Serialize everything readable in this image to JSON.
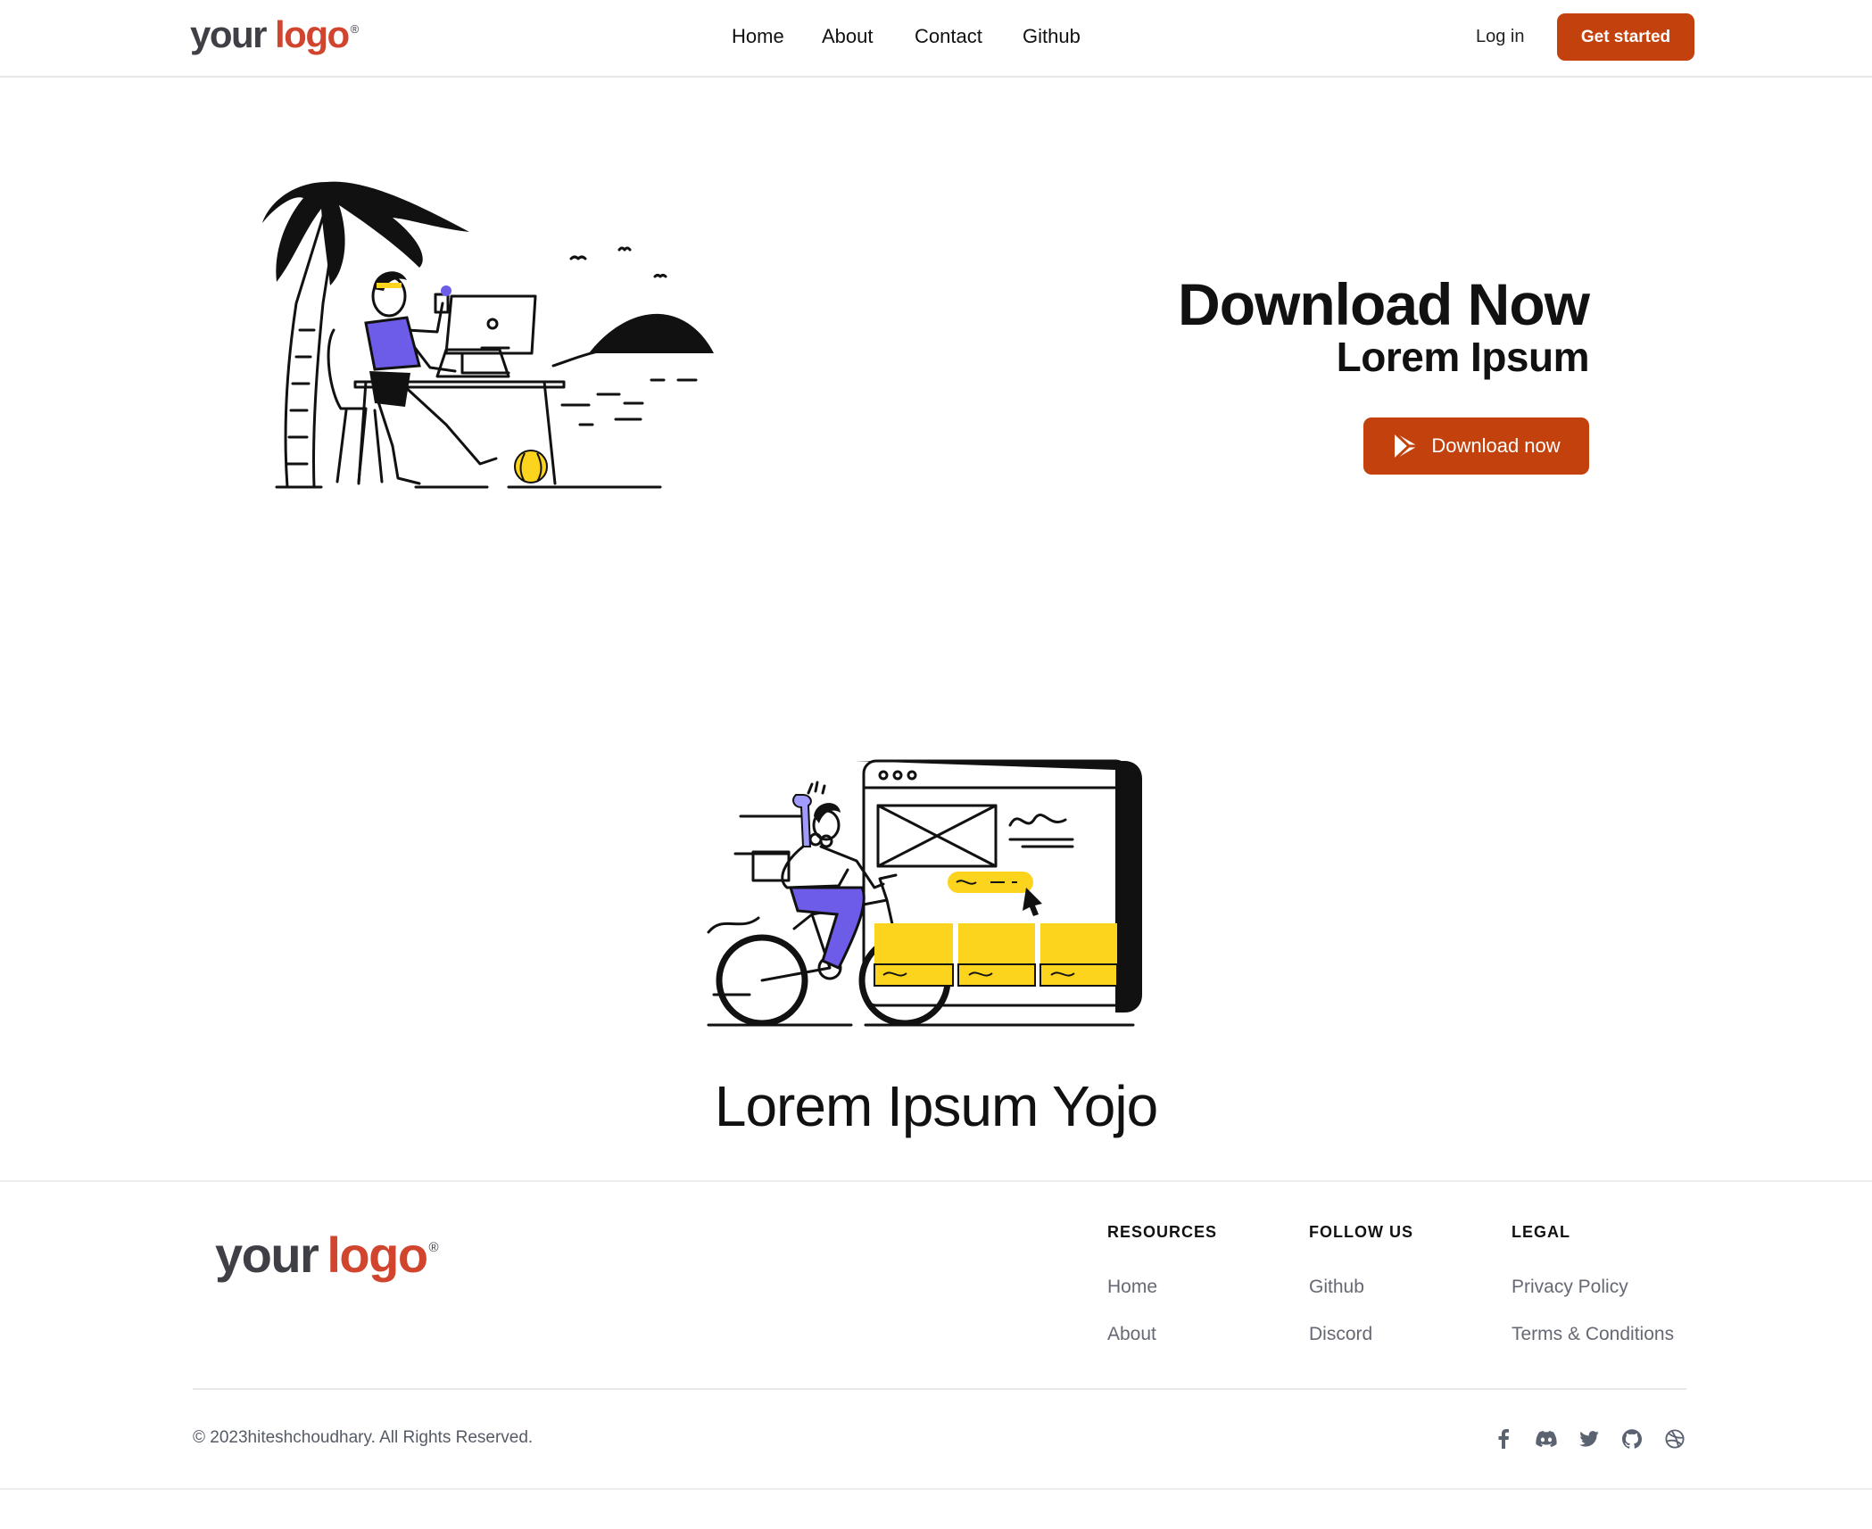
{
  "header": {
    "logo": {
      "word1": "your",
      "word2": "logo",
      "mark": "®"
    },
    "nav": [
      {
        "label": "Home"
      },
      {
        "label": "About"
      },
      {
        "label": "Contact"
      },
      {
        "label": "Github"
      }
    ],
    "login_label": "Log in",
    "cta_label": "Get started"
  },
  "hero": {
    "title": "Download Now",
    "subtitle": "Lorem Ipsum",
    "download_label": "Download now",
    "download_icon": "play-store-icon"
  },
  "feature": {
    "title": "Lorem Ipsum Yojo"
  },
  "footer": {
    "logo": {
      "word1": "your",
      "word2": "logo",
      "mark": "®"
    },
    "columns": [
      {
        "title": "RESOURCES",
        "links": [
          "Home",
          "About"
        ]
      },
      {
        "title": "FOLLOW US",
        "links": [
          "Github",
          "Discord"
        ]
      },
      {
        "title": "LEGAL",
        "links": [
          "Privacy Policy",
          "Terms & Conditions"
        ]
      }
    ],
    "copyright": "© 2023hiteshchoudhary. All Rights Reserved.",
    "social_icons": [
      "facebook-icon",
      "discord-icon",
      "twitter-icon",
      "github-icon",
      "dribbble-icon"
    ]
  },
  "colors": {
    "brand": "#c2410c",
    "logo_accent": "#d1442d",
    "illustration_purple": "#6c5ce7",
    "illustration_yellow": "#fcd31d"
  }
}
